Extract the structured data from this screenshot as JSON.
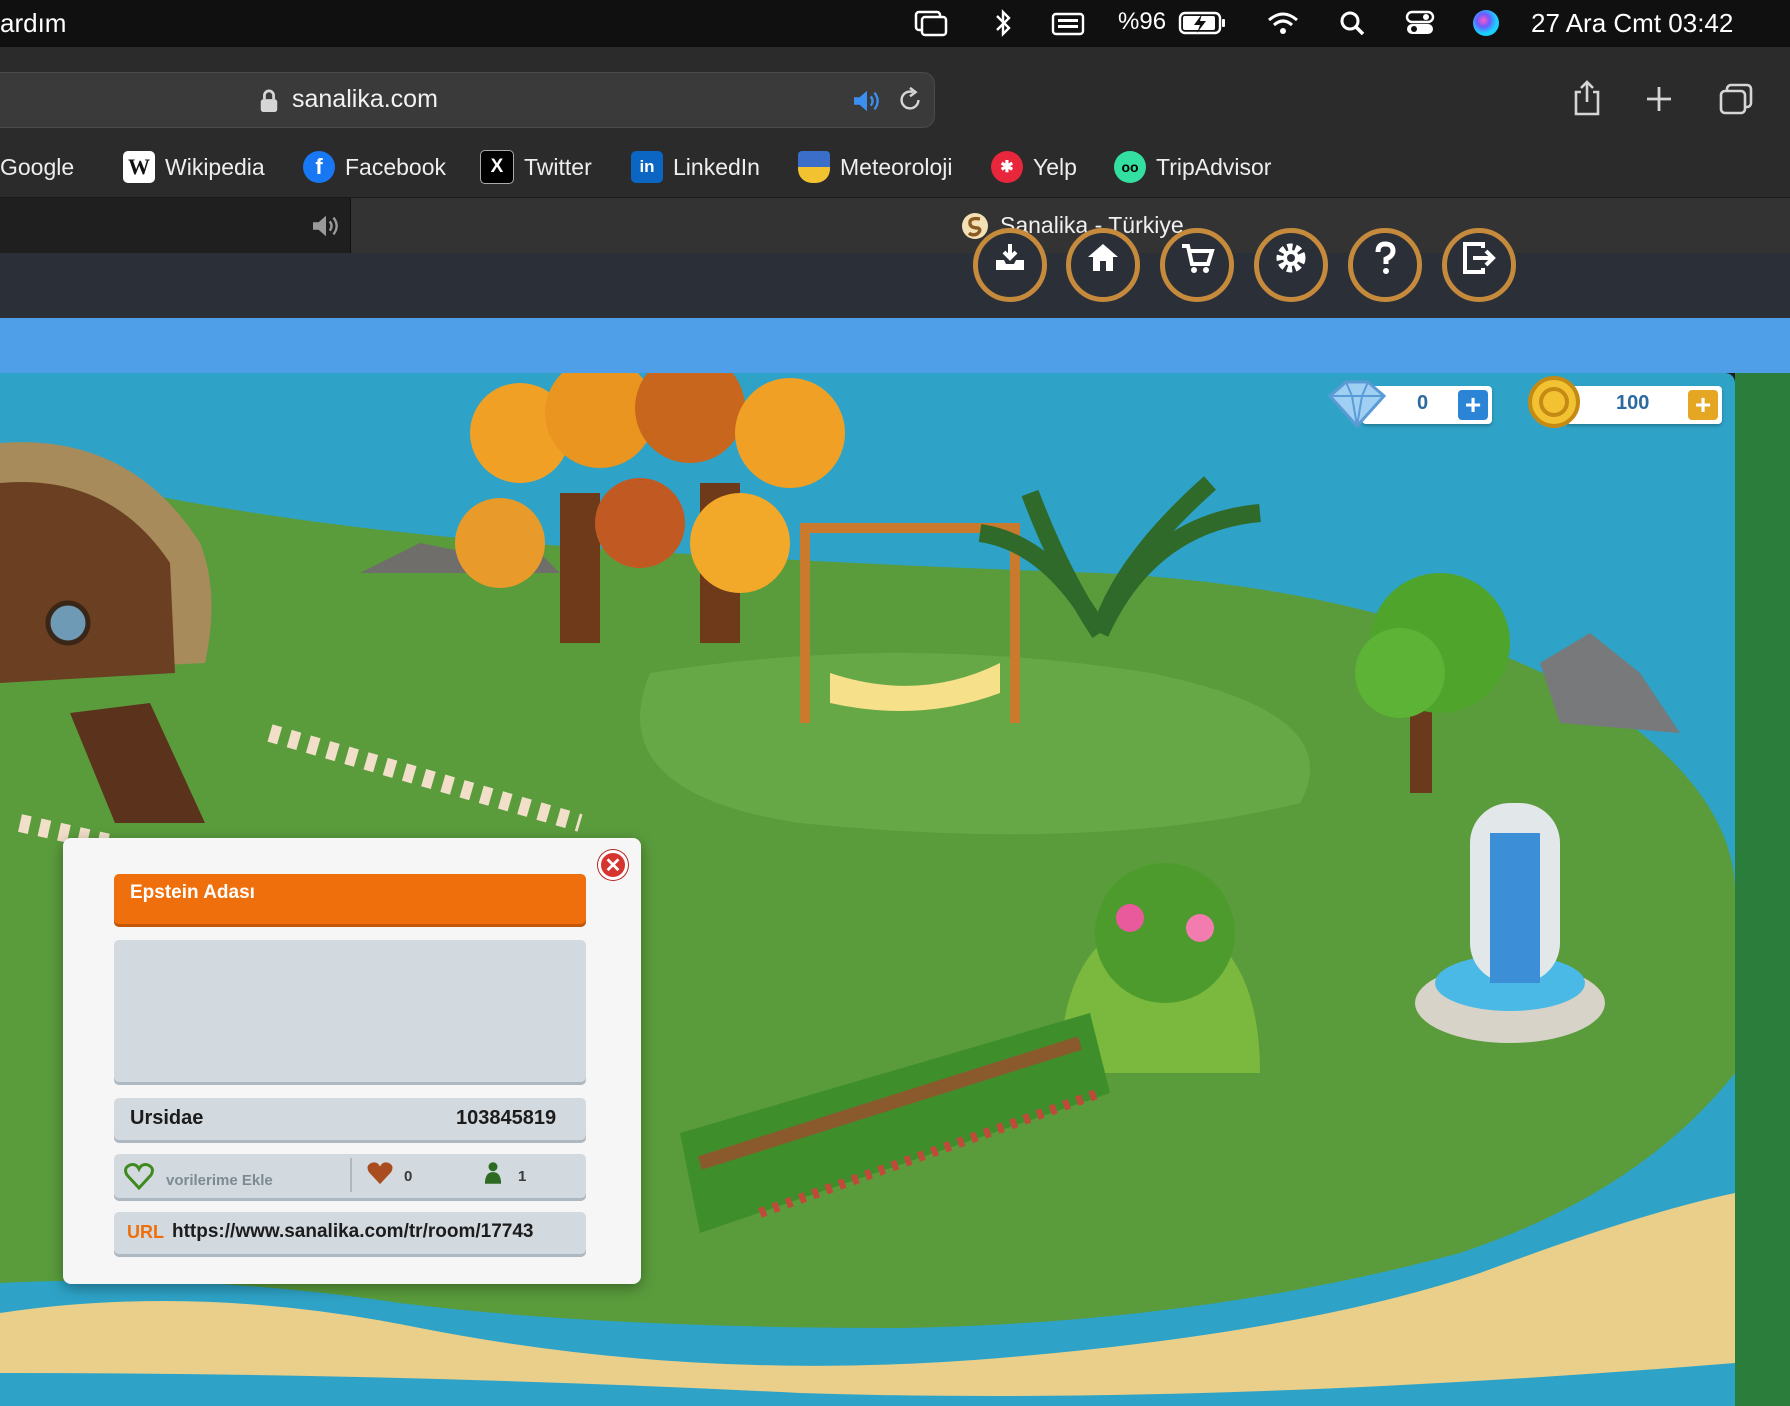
{
  "menubar": {
    "app_menu": "ardım",
    "battery": "%96",
    "datetime": "27 Ara Cmt  03:42"
  },
  "toolbar": {
    "url": "sanalika.com"
  },
  "favorites": [
    {
      "label": "Google",
      "icon": "google-icon",
      "color": "#2b2b2b"
    },
    {
      "label": "Wikipedia",
      "icon": "wikipedia-icon",
      "color": "#ffffff"
    },
    {
      "label": "Facebook",
      "icon": "facebook-icon",
      "color": "#1877f2"
    },
    {
      "label": "Twitter",
      "icon": "x-icon",
      "color": "#000000"
    },
    {
      "label": "LinkedIn",
      "icon": "linkedin-icon",
      "color": "#0a66c2"
    },
    {
      "label": "Meteoroloji",
      "icon": "meteoroloji-icon",
      "color": "#f2c230"
    },
    {
      "label": "Yelp",
      "icon": "yelp-icon",
      "color": "#e8263c"
    },
    {
      "label": "TripAdvisor",
      "icon": "tripadvisor-icon",
      "color": "#34e0a1"
    }
  ],
  "tabs": {
    "active_tab_title": "Sanalika - Türkiye"
  },
  "game": {
    "diamonds": "0",
    "coins": "100",
    "header_buttons": [
      "inbox-icon",
      "home-icon",
      "cart-icon",
      "settings-icon",
      "help-icon",
      "logout-icon"
    ]
  },
  "room_dialog": {
    "title": "Epstein Adası",
    "owner": "Ursidae",
    "owner_id": "103845819",
    "favorite_label": "vorilerime Ekle",
    "likes": "0",
    "visitors": "1",
    "url_label": "URL",
    "url": "https://www.sanalika.com/tr/room/17743"
  },
  "colors": {
    "accent_orange": "#ee6f0b",
    "currency_plus_blue": "#2b84d6",
    "currency_plus_gold": "#e5a623",
    "header_ring": "#c58a3c"
  }
}
